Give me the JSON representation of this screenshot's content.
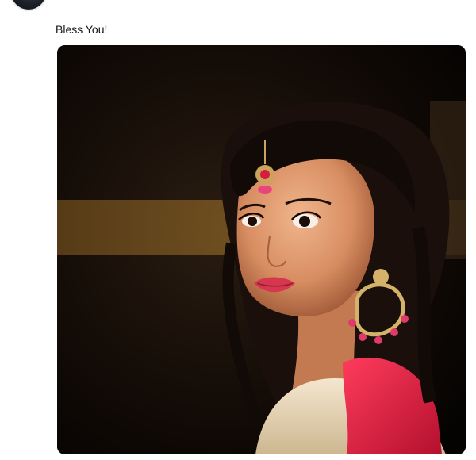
{
  "tweet": {
    "header_partial": "",
    "text": "Bless You!"
  },
  "media": {
    "icon": "photo",
    "accent_red": "#d81c3f",
    "background": "#0c0806"
  }
}
